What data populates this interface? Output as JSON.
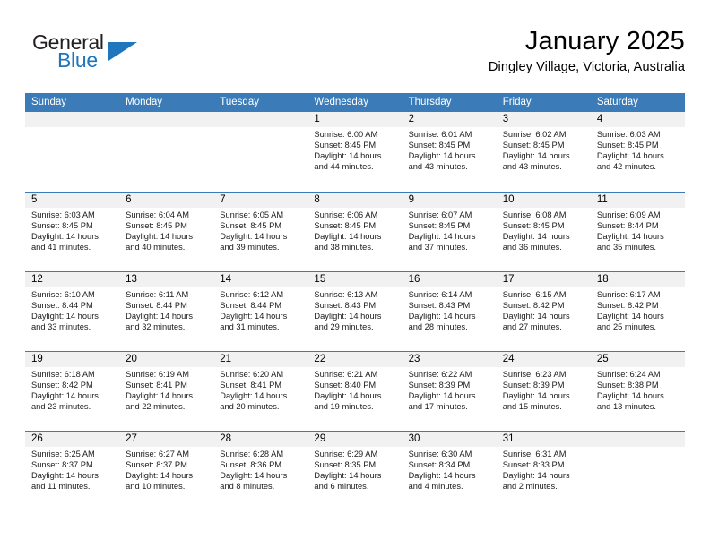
{
  "brand": {
    "name_part1": "General",
    "name_part2": "Blue",
    "accent_color": "#1f76bd"
  },
  "header": {
    "title": "January 2025",
    "subtitle": "Dingley Village, Victoria, Australia"
  },
  "theme": {
    "header_blue": "#3b7cb8",
    "date_strip_gray": "#f1f1f1"
  },
  "weekdays": [
    "Sunday",
    "Monday",
    "Tuesday",
    "Wednesday",
    "Thursday",
    "Friday",
    "Saturday"
  ],
  "weeks": [
    [
      {
        "day": "",
        "empty": true,
        "sunrise": "",
        "sunset": "",
        "daylight_line1": "",
        "daylight_line2": ""
      },
      {
        "day": "",
        "empty": true,
        "sunrise": "",
        "sunset": "",
        "daylight_line1": "",
        "daylight_line2": ""
      },
      {
        "day": "",
        "empty": true,
        "sunrise": "",
        "sunset": "",
        "daylight_line1": "",
        "daylight_line2": ""
      },
      {
        "day": "1",
        "empty": false,
        "sunrise": "Sunrise: 6:00 AM",
        "sunset": "Sunset: 8:45 PM",
        "daylight_line1": "Daylight: 14 hours",
        "daylight_line2": "and 44 minutes."
      },
      {
        "day": "2",
        "empty": false,
        "sunrise": "Sunrise: 6:01 AM",
        "sunset": "Sunset: 8:45 PM",
        "daylight_line1": "Daylight: 14 hours",
        "daylight_line2": "and 43 minutes."
      },
      {
        "day": "3",
        "empty": false,
        "sunrise": "Sunrise: 6:02 AM",
        "sunset": "Sunset: 8:45 PM",
        "daylight_line1": "Daylight: 14 hours",
        "daylight_line2": "and 43 minutes."
      },
      {
        "day": "4",
        "empty": false,
        "sunrise": "Sunrise: 6:03 AM",
        "sunset": "Sunset: 8:45 PM",
        "daylight_line1": "Daylight: 14 hours",
        "daylight_line2": "and 42 minutes."
      }
    ],
    [
      {
        "day": "5",
        "empty": false,
        "sunrise": "Sunrise: 6:03 AM",
        "sunset": "Sunset: 8:45 PM",
        "daylight_line1": "Daylight: 14 hours",
        "daylight_line2": "and 41 minutes."
      },
      {
        "day": "6",
        "empty": false,
        "sunrise": "Sunrise: 6:04 AM",
        "sunset": "Sunset: 8:45 PM",
        "daylight_line1": "Daylight: 14 hours",
        "daylight_line2": "and 40 minutes."
      },
      {
        "day": "7",
        "empty": false,
        "sunrise": "Sunrise: 6:05 AM",
        "sunset": "Sunset: 8:45 PM",
        "daylight_line1": "Daylight: 14 hours",
        "daylight_line2": "and 39 minutes."
      },
      {
        "day": "8",
        "empty": false,
        "sunrise": "Sunrise: 6:06 AM",
        "sunset": "Sunset: 8:45 PM",
        "daylight_line1": "Daylight: 14 hours",
        "daylight_line2": "and 38 minutes."
      },
      {
        "day": "9",
        "empty": false,
        "sunrise": "Sunrise: 6:07 AM",
        "sunset": "Sunset: 8:45 PM",
        "daylight_line1": "Daylight: 14 hours",
        "daylight_line2": "and 37 minutes."
      },
      {
        "day": "10",
        "empty": false,
        "sunrise": "Sunrise: 6:08 AM",
        "sunset": "Sunset: 8:45 PM",
        "daylight_line1": "Daylight: 14 hours",
        "daylight_line2": "and 36 minutes."
      },
      {
        "day": "11",
        "empty": false,
        "sunrise": "Sunrise: 6:09 AM",
        "sunset": "Sunset: 8:44 PM",
        "daylight_line1": "Daylight: 14 hours",
        "daylight_line2": "and 35 minutes."
      }
    ],
    [
      {
        "day": "12",
        "empty": false,
        "sunrise": "Sunrise: 6:10 AM",
        "sunset": "Sunset: 8:44 PM",
        "daylight_line1": "Daylight: 14 hours",
        "daylight_line2": "and 33 minutes."
      },
      {
        "day": "13",
        "empty": false,
        "sunrise": "Sunrise: 6:11 AM",
        "sunset": "Sunset: 8:44 PM",
        "daylight_line1": "Daylight: 14 hours",
        "daylight_line2": "and 32 minutes."
      },
      {
        "day": "14",
        "empty": false,
        "sunrise": "Sunrise: 6:12 AM",
        "sunset": "Sunset: 8:44 PM",
        "daylight_line1": "Daylight: 14 hours",
        "daylight_line2": "and 31 minutes."
      },
      {
        "day": "15",
        "empty": false,
        "sunrise": "Sunrise: 6:13 AM",
        "sunset": "Sunset: 8:43 PM",
        "daylight_line1": "Daylight: 14 hours",
        "daylight_line2": "and 29 minutes."
      },
      {
        "day": "16",
        "empty": false,
        "sunrise": "Sunrise: 6:14 AM",
        "sunset": "Sunset: 8:43 PM",
        "daylight_line1": "Daylight: 14 hours",
        "daylight_line2": "and 28 minutes."
      },
      {
        "day": "17",
        "empty": false,
        "sunrise": "Sunrise: 6:15 AM",
        "sunset": "Sunset: 8:42 PM",
        "daylight_line1": "Daylight: 14 hours",
        "daylight_line2": "and 27 minutes."
      },
      {
        "day": "18",
        "empty": false,
        "sunrise": "Sunrise: 6:17 AM",
        "sunset": "Sunset: 8:42 PM",
        "daylight_line1": "Daylight: 14 hours",
        "daylight_line2": "and 25 minutes."
      }
    ],
    [
      {
        "day": "19",
        "empty": false,
        "sunrise": "Sunrise: 6:18 AM",
        "sunset": "Sunset: 8:42 PM",
        "daylight_line1": "Daylight: 14 hours",
        "daylight_line2": "and 23 minutes."
      },
      {
        "day": "20",
        "empty": false,
        "sunrise": "Sunrise: 6:19 AM",
        "sunset": "Sunset: 8:41 PM",
        "daylight_line1": "Daylight: 14 hours",
        "daylight_line2": "and 22 minutes."
      },
      {
        "day": "21",
        "empty": false,
        "sunrise": "Sunrise: 6:20 AM",
        "sunset": "Sunset: 8:41 PM",
        "daylight_line1": "Daylight: 14 hours",
        "daylight_line2": "and 20 minutes."
      },
      {
        "day": "22",
        "empty": false,
        "sunrise": "Sunrise: 6:21 AM",
        "sunset": "Sunset: 8:40 PM",
        "daylight_line1": "Daylight: 14 hours",
        "daylight_line2": "and 19 minutes."
      },
      {
        "day": "23",
        "empty": false,
        "sunrise": "Sunrise: 6:22 AM",
        "sunset": "Sunset: 8:39 PM",
        "daylight_line1": "Daylight: 14 hours",
        "daylight_line2": "and 17 minutes."
      },
      {
        "day": "24",
        "empty": false,
        "sunrise": "Sunrise: 6:23 AM",
        "sunset": "Sunset: 8:39 PM",
        "daylight_line1": "Daylight: 14 hours",
        "daylight_line2": "and 15 minutes."
      },
      {
        "day": "25",
        "empty": false,
        "sunrise": "Sunrise: 6:24 AM",
        "sunset": "Sunset: 8:38 PM",
        "daylight_line1": "Daylight: 14 hours",
        "daylight_line2": "and 13 minutes."
      }
    ],
    [
      {
        "day": "26",
        "empty": false,
        "sunrise": "Sunrise: 6:25 AM",
        "sunset": "Sunset: 8:37 PM",
        "daylight_line1": "Daylight: 14 hours",
        "daylight_line2": "and 11 minutes."
      },
      {
        "day": "27",
        "empty": false,
        "sunrise": "Sunrise: 6:27 AM",
        "sunset": "Sunset: 8:37 PM",
        "daylight_line1": "Daylight: 14 hours",
        "daylight_line2": "and 10 minutes."
      },
      {
        "day": "28",
        "empty": false,
        "sunrise": "Sunrise: 6:28 AM",
        "sunset": "Sunset: 8:36 PM",
        "daylight_line1": "Daylight: 14 hours",
        "daylight_line2": "and 8 minutes."
      },
      {
        "day": "29",
        "empty": false,
        "sunrise": "Sunrise: 6:29 AM",
        "sunset": "Sunset: 8:35 PM",
        "daylight_line1": "Daylight: 14 hours",
        "daylight_line2": "and 6 minutes."
      },
      {
        "day": "30",
        "empty": false,
        "sunrise": "Sunrise: 6:30 AM",
        "sunset": "Sunset: 8:34 PM",
        "daylight_line1": "Daylight: 14 hours",
        "daylight_line2": "and 4 minutes."
      },
      {
        "day": "31",
        "empty": false,
        "sunrise": "Sunrise: 6:31 AM",
        "sunset": "Sunset: 8:33 PM",
        "daylight_line1": "Daylight: 14 hours",
        "daylight_line2": "and 2 minutes."
      },
      {
        "day": "",
        "empty": true,
        "sunrise": "",
        "sunset": "",
        "daylight_line1": "",
        "daylight_line2": ""
      }
    ]
  ]
}
